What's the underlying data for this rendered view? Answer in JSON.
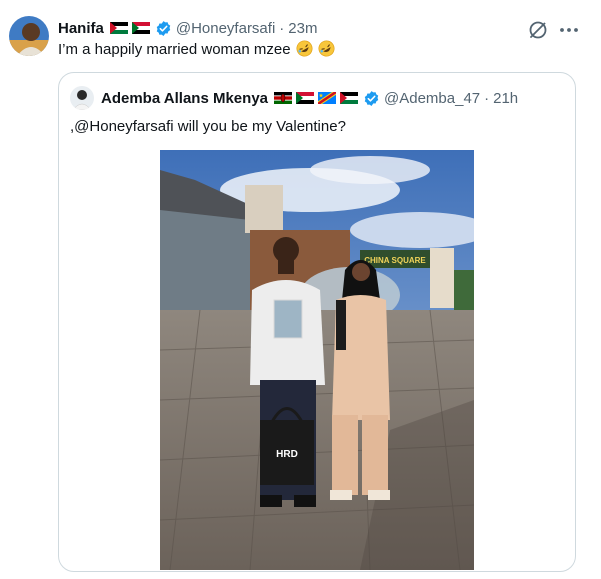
{
  "tweet": {
    "author_name": "Hanifa",
    "flags": [
      "palestine-flag",
      "sudan-flag"
    ],
    "verified": true,
    "handle": "@Honeyfarsafi",
    "separator": "·",
    "time": "23m",
    "text": "I’m a happily married woman mzee",
    "emojis": [
      "rolling-on-floor-laughing-icon",
      "rolling-on-floor-laughing-icon"
    ]
  },
  "quoted_tweet": {
    "author_name": "Ademba Allans Mkenya",
    "flags": [
      "kenya-flag",
      "sudan-flag",
      "congo-flag",
      "palestine-flag"
    ],
    "verified": true,
    "handle": "@Ademba_47",
    "separator": "·",
    "time": "21h",
    "text": ",@Honeyfarsafi will you be my Valentine?",
    "photo": {
      "alt": "Photo of a couple standing in a paved plaza",
      "sign_text": "CHINA SQUARE",
      "bag_text": "HRD"
    }
  },
  "colors": {
    "text_primary": "#0f1419",
    "text_secondary": "#536471",
    "verified_blue": "#1d9bf0",
    "border": "#cfd9de"
  }
}
